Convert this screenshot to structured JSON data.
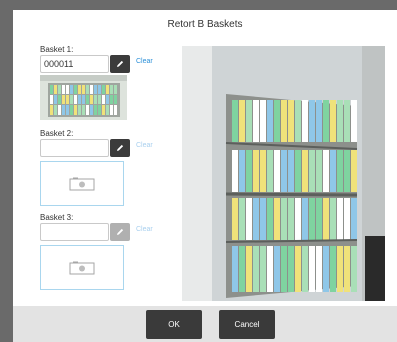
{
  "dialog": {
    "title": "Retort B Baskets"
  },
  "baskets": [
    {
      "label": "Basket 1:",
      "value": "000011",
      "clear": "Clear",
      "has_image": true
    },
    {
      "label": "Basket 2:",
      "value": "",
      "clear": "Clear",
      "has_image": false
    },
    {
      "label": "Basket 3:",
      "value": "",
      "clear": "Clear",
      "has_image": false
    }
  ],
  "icons": {
    "edit": "pencil-icon",
    "camera": "camera-icon"
  },
  "colors": {
    "link": "#2a8fd8",
    "link_disabled": "#a9d0ef",
    "button_dark": "#3a3a3a",
    "empty_border": "#a9d6ee"
  },
  "buttons": {
    "ok": "OK",
    "cancel": "Cancel"
  }
}
